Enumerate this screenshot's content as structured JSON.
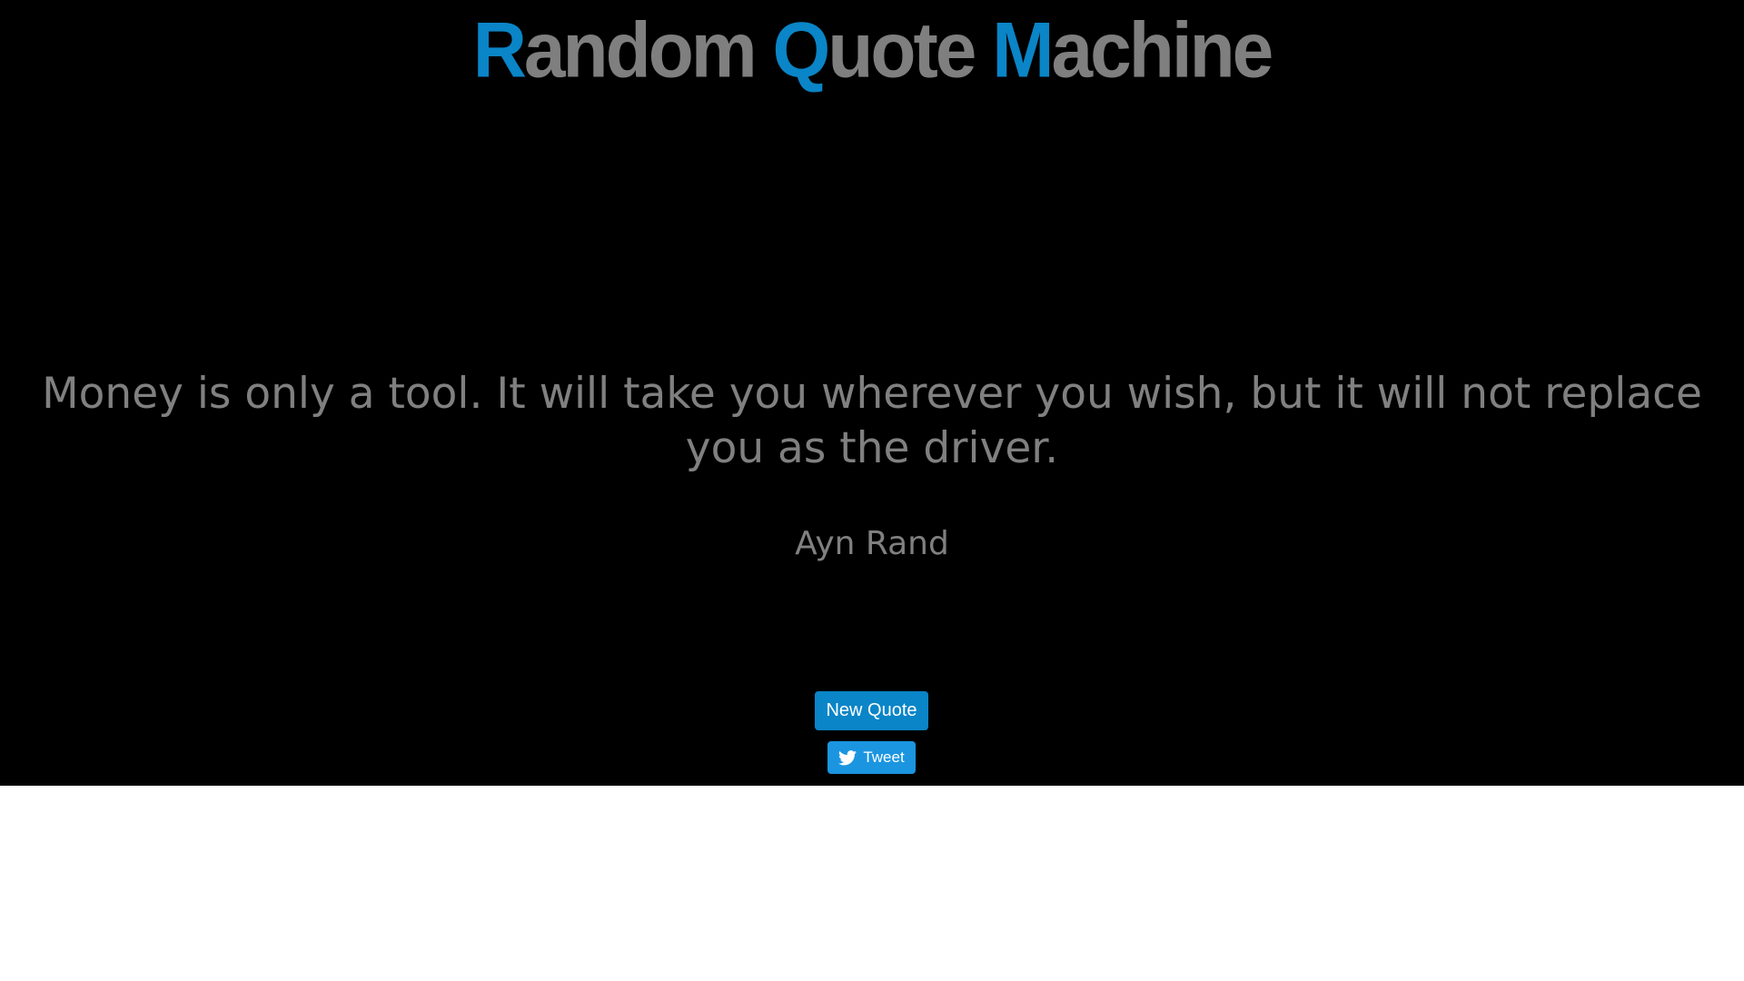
{
  "header": {
    "title_parts": [
      {
        "initial": "R",
        "rest": "andom"
      },
      {
        "initial": "Q",
        "rest": "uote"
      },
      {
        "initial": "M",
        "rest": "achine"
      }
    ]
  },
  "quote": {
    "text": "Money is only a tool. It will take you wherever you wish, but it will not replace you as the driver.",
    "author": "Ayn Rand"
  },
  "actions": {
    "new_quote_label": "New Quote",
    "tweet_label": "Tweet",
    "tweet_icon": "twitter-bird-icon"
  },
  "colors": {
    "background": "#000000",
    "page_below": "#ffffff",
    "accent": "#0a85c7",
    "text": "#808080",
    "tweet_button": "#1b95e0"
  }
}
